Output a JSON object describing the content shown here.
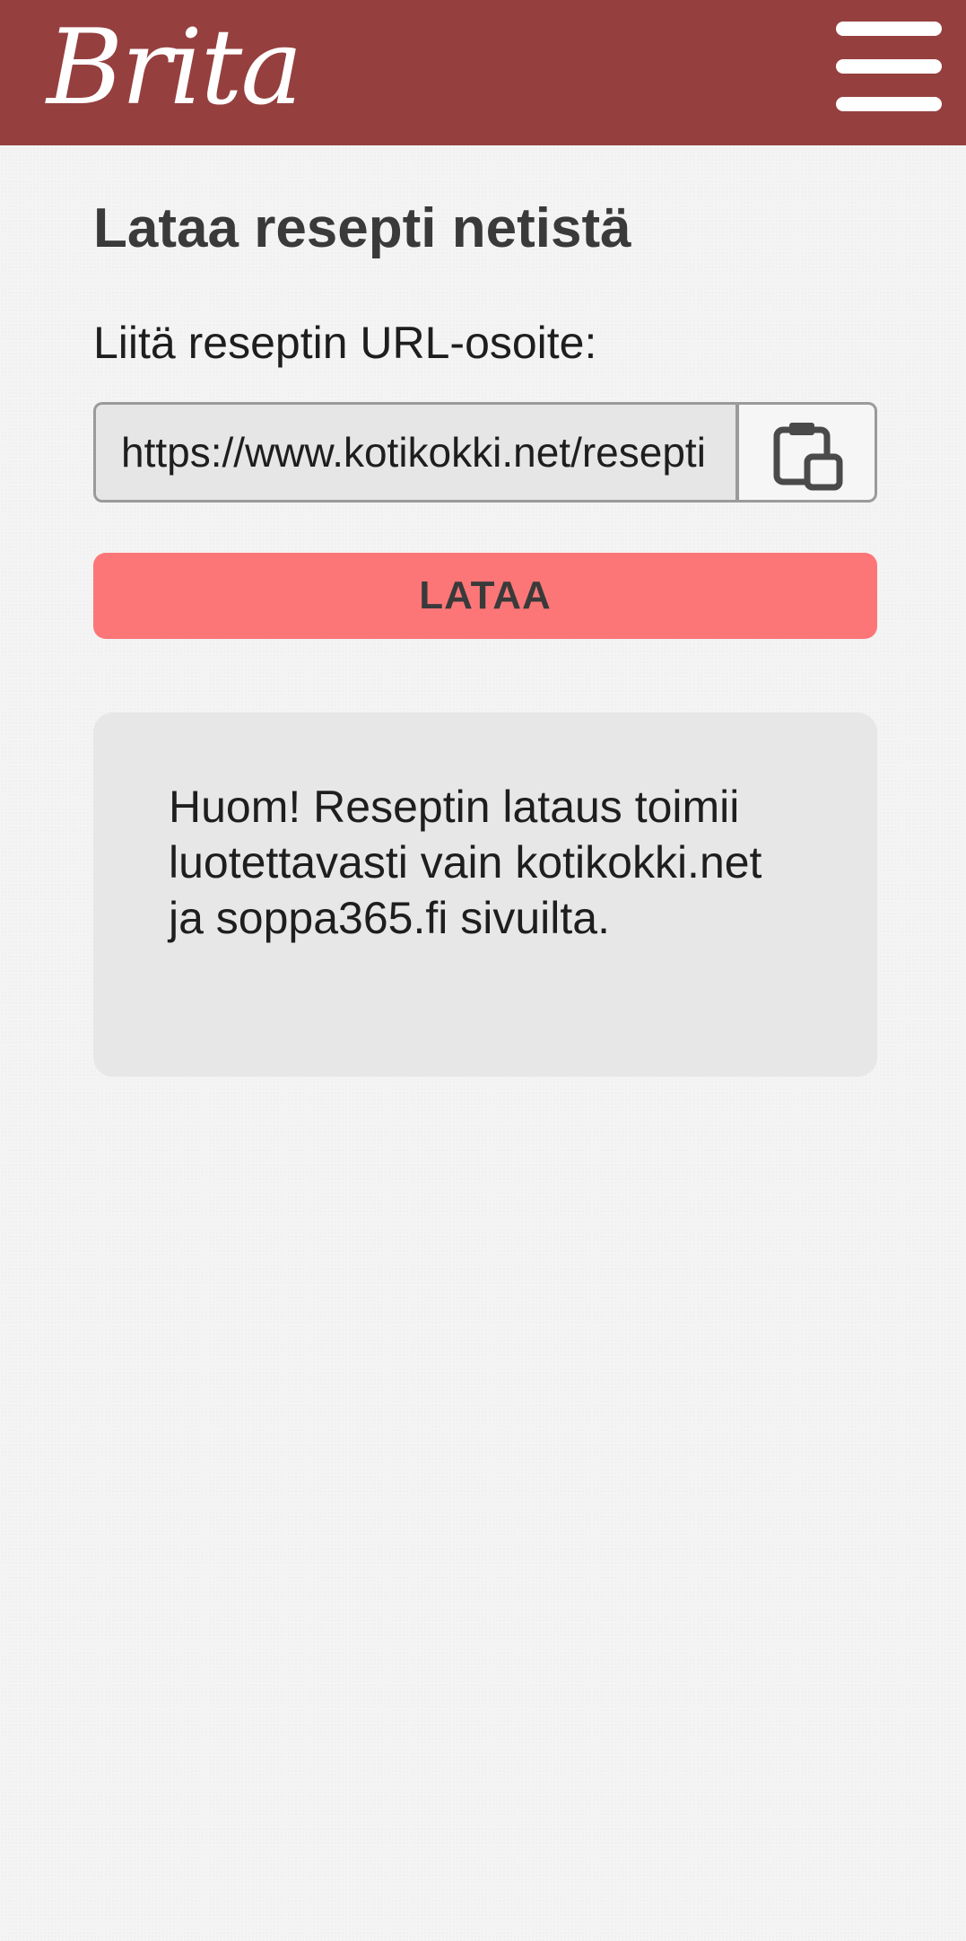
{
  "header": {
    "logo_text": "Brita",
    "background_color": "#963f3f",
    "menu_icon": "hamburger-menu-icon"
  },
  "main": {
    "title": "Lataa resepti netistä",
    "url_label": "Liitä reseptin URL-osoite:",
    "url_value": "https://www.kotikokki.net/resepti",
    "paste_icon": "clipboard-paste-icon",
    "load_button_label": "LATAA",
    "load_button_color": "#fd7677",
    "notice_text": "Huom! Reseptin lataus toimii luotettavasti vain kotikokki.net ja soppa365.fi sivuilta."
  }
}
